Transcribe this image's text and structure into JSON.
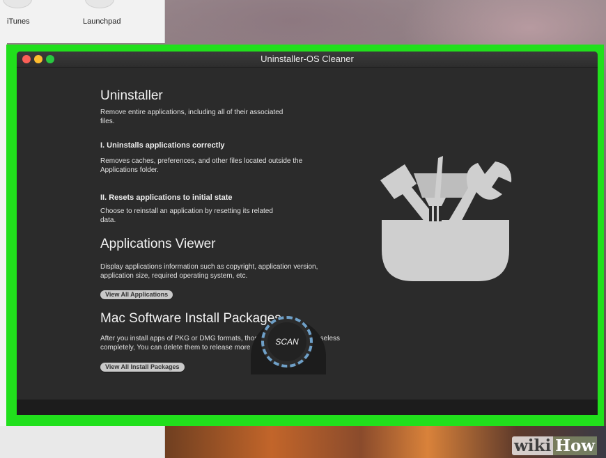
{
  "dock": {
    "labels": [
      "iTunes",
      "Launchpad"
    ]
  },
  "window": {
    "title": "Uninstaller-OS Cleaner"
  },
  "sections": {
    "uninstaller": {
      "title": "Uninstaller",
      "description_lines": [
        "Remove entire applications, including all of their associated",
        "files."
      ],
      "feature1_title": "I. Uninstalls applications correctly",
      "feature1_lines": [
        "Removes caches, preferences, and other files located outside the",
        "Applications folder."
      ],
      "feature2_title": "II. Resets applications to initial state",
      "feature2_lines": [
        "Choose to reinstall an application by resetting its related",
        "data."
      ]
    },
    "viewer": {
      "title": "Applications Viewer",
      "description_lines": [
        "Display applications information such as copyright, application version,",
        "application size, required operating system, etc."
      ],
      "button": "View All Applications"
    },
    "packages": {
      "title": "Mac Software Install Packages",
      "description_lines": [
        "After you install apps of PKG or DMG formats, those files will become useless",
        "completely, You can delete them to release more space on your mac."
      ],
      "button": "View All Install Packages"
    }
  },
  "scan": {
    "label": "SCAN"
  },
  "watermark": {
    "wiki": "wiki",
    "how": "How"
  },
  "colors": {
    "highlight_frame": "#21e01c",
    "window_bg": "#2b2b2b",
    "scan_ring": "#6fa0c8"
  },
  "icons": {
    "toolbox": "toolbox-icon"
  }
}
